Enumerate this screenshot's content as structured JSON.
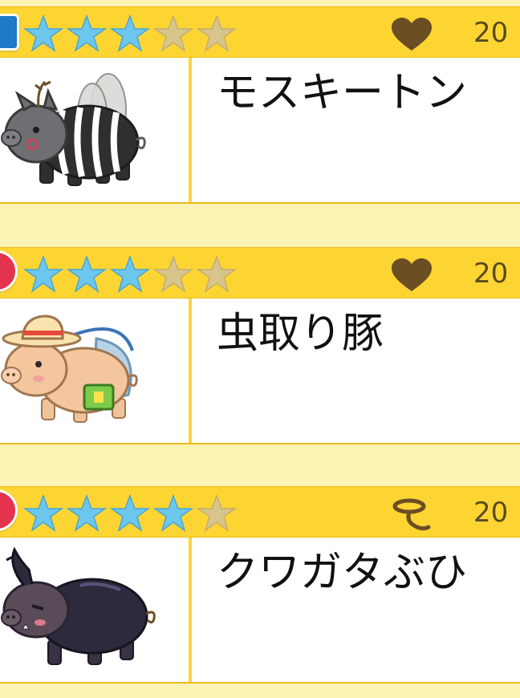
{
  "colors": {
    "header_bg": "#fdd533",
    "page_bg": "#fdf3b4",
    "star_filled": "#6dc6ec",
    "star_empty": "#d8c58c",
    "icon_brown": "#6b4e23"
  },
  "cards": [
    {
      "badge_color": "#1f78c8",
      "rating": 3,
      "max_rating": 5,
      "trait_icon": "heart-icon",
      "count": "20",
      "name": "モスキートン",
      "image": "mosquito-pig-illustration"
    },
    {
      "badge_color": "#e4334e",
      "rating": 3,
      "max_rating": 5,
      "trait_icon": "heart-icon",
      "count": "20",
      "name": "虫取り豚",
      "image": "bug-catcher-pig-illustration"
    },
    {
      "badge_color": "#e4334e",
      "rating": 4,
      "max_rating": 5,
      "trait_icon": "lasso-icon",
      "count": "20",
      "name": "クワガタぶひ",
      "image": "stag-beetle-pig-illustration"
    }
  ]
}
